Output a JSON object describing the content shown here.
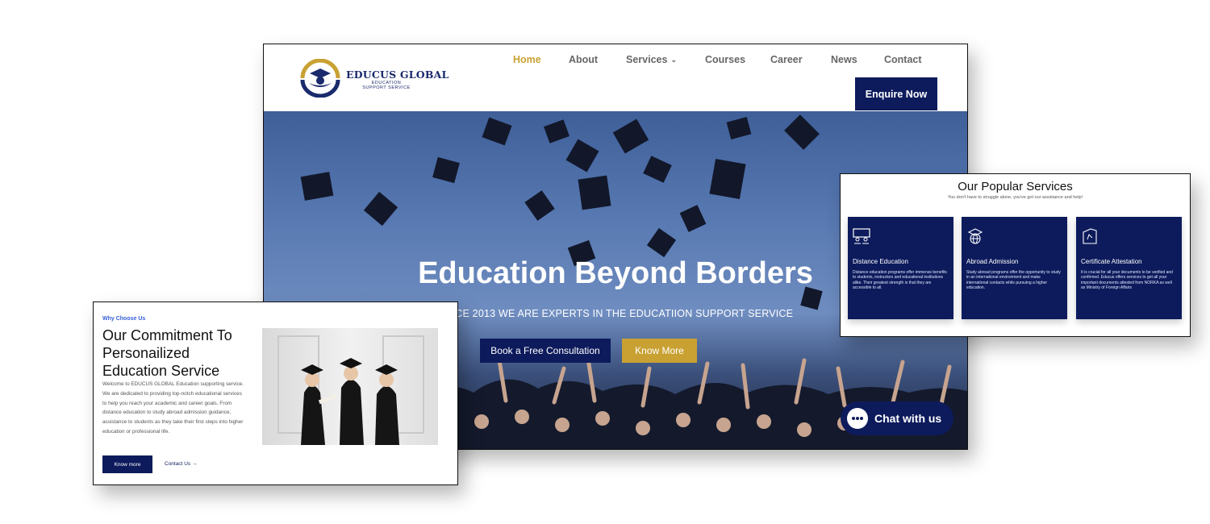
{
  "brand": {
    "name": "EDUCUS GLOBAL",
    "tagline": "EDUCATION SUPPORT SERVICE"
  },
  "nav": {
    "items": [
      {
        "label": "Home",
        "active": true
      },
      {
        "label": "About"
      },
      {
        "label": "Services",
        "has_dropdown": true
      },
      {
        "label": "Courses"
      },
      {
        "label": "Career"
      },
      {
        "label": "News"
      },
      {
        "label": "Contact"
      }
    ],
    "cta": "Enquire Now"
  },
  "hero": {
    "title": "Education Beyond Borders",
    "subtitle": "SINCE 2013 WE ARE EXPERTS IN THE EDUCATIION SUPPORT SERVICE",
    "primary_button": "Book a Free Consultation",
    "secondary_button": "Know More"
  },
  "chat": {
    "label": "Chat with us"
  },
  "services": {
    "title": "Our Popular Services",
    "subtitle": "You don't have to struggle alone, you've got our assistance and help!",
    "cards": [
      {
        "icon": "classroom-icon",
        "title": "Distance Education",
        "description": "Distance education programs offer immense benefits to students, instructors and educational institutions alike. Their greatest strength is that they are accessible to all."
      },
      {
        "icon": "globe-graduation-icon",
        "title": "Abroad Admission",
        "description": "Study abroad programs offer the opportunity to study in an international environment and make international contacts while pursuing a higher education."
      },
      {
        "icon": "certificate-icon",
        "title": "Certificate Attestation",
        "description": "It is crucial for all your documents to be verified and confirmed. Educus offers services to get all your important documents attested from NORKA as well as Ministry of Foreign Affairs"
      }
    ]
  },
  "why": {
    "kicker": "Why Choose Us",
    "title": "Our Commitment To Personailized Education Service",
    "body": "Welcome to EDUCUS GLOBAL Education supporting service. We are dedicated to providing top-notch educational services to help you reach your academic and career goals. From distance education to study abroad admission guidance, assistance to students as they take their first steps into higher education or professional life.",
    "button": "Know more",
    "link": "Contact Us"
  },
  "colors": {
    "navy": "#0d1b5c",
    "gold": "#c9a133",
    "kicker_blue": "#3560d6"
  }
}
